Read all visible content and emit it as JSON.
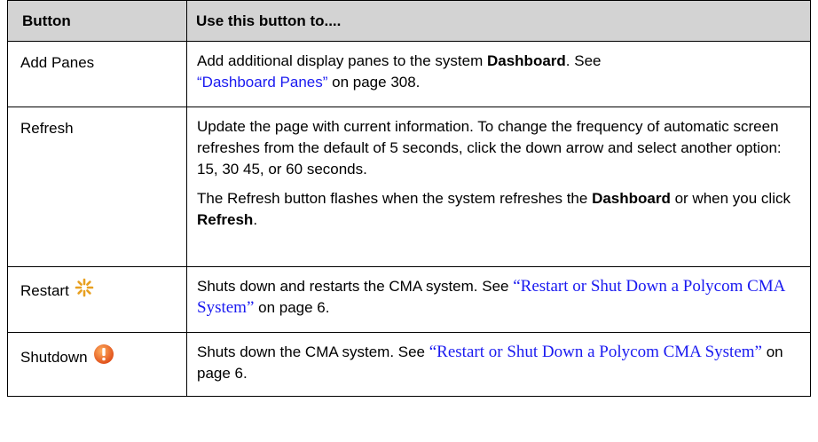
{
  "table": {
    "headers": [
      "Button",
      "Use this button to...."
    ],
    "rows": [
      {
        "button": "Add Panes",
        "text_1": "Add additional display panes to the system ",
        "bold_1": "Dashboard",
        "text_2": ". See ",
        "link": "“Dashboard Panes”",
        "text_3": " on page 308."
      },
      {
        "button": "Refresh",
        "para_1": "Update the page with current information. To change the frequency of automatic screen refreshes from the default of 5 seconds, click the down arrow and select another option: 15, 30 45, or 60 seconds.",
        "para_2_text_1": "The Refresh button flashes when the system refreshes the ",
        "para_2_bold_1": "Dashboard",
        "para_2_text_2": " or when you click ",
        "para_2_bold_2": "Refresh",
        "para_2_text_3": "."
      },
      {
        "button": "Restart",
        "icon": "restart-icon",
        "icon_color": "#e8a020",
        "text_1": "Shuts down and restarts the CMA system. See ",
        "link": "“Restart or Shut Down a Polycom CMA System”",
        "text_2": " on page 6."
      },
      {
        "button": "Shutdown",
        "icon": "shutdown-icon",
        "icon_color": "#e8641e",
        "text_1": "Shuts down the CMA system. See ",
        "link": "“Restart or Shut Down a Polycom CMA System”",
        "text_2": " on page 6."
      }
    ]
  },
  "colors": {
    "header_bg": "#d3d3d3",
    "link": "#1a1af0"
  }
}
